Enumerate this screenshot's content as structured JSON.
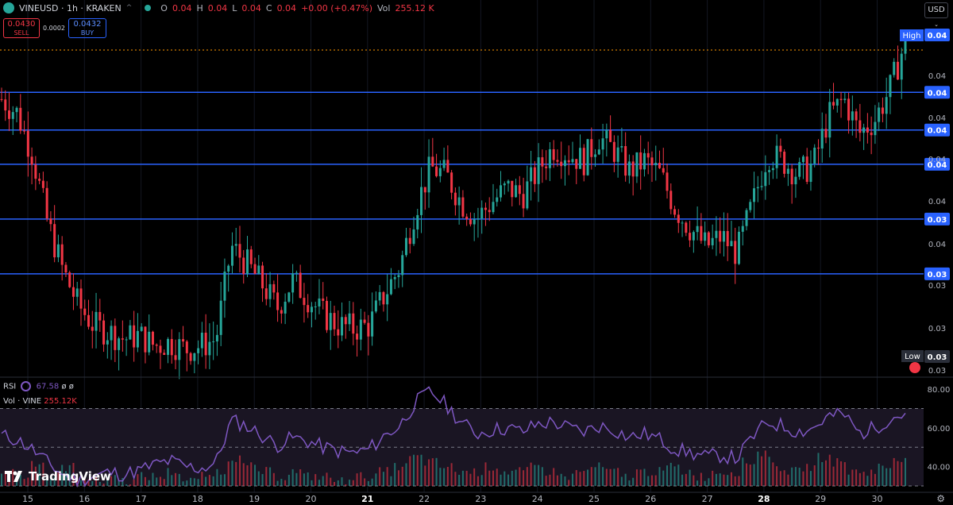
{
  "header": {
    "symbol": "VINEUSD · 1h · KRAKEN",
    "ohlc": [
      {
        "k": "O",
        "v": "0.04"
      },
      {
        "k": "H",
        "v": "0.04"
      },
      {
        "k": "L",
        "v": "0.04"
      },
      {
        "k": "C",
        "v": "0.04"
      }
    ],
    "change": "+0.00 (+0.47%)",
    "vol_label": "Vol",
    "vol_value": "255.12 K"
  },
  "trade": {
    "sell_price": "0.0430",
    "sell_label": "SELL",
    "spread": "0.0002",
    "buy_price": "0.0432",
    "buy_label": "BUY"
  },
  "currency": "USD",
  "price_axis": {
    "tick_labels": [
      "0.04",
      "0.04",
      "0.04",
      "0.04",
      "0.04",
      "0.03",
      "0.03",
      "0.03",
      "0.03"
    ],
    "high_label": "High",
    "high_value": "0.04",
    "low_label": "Low",
    "low_value": "0.03"
  },
  "horizontal_lines": [
    {
      "label": "0.04"
    },
    {
      "label": "0.04"
    },
    {
      "label": "0.04"
    },
    {
      "label": "0.03"
    },
    {
      "label": "0.03"
    }
  ],
  "time_axis": [
    "15",
    "16",
    "17",
    "18",
    "19",
    "20",
    "21",
    "22",
    "23",
    "24",
    "25",
    "26",
    "27",
    "28",
    "29",
    "30"
  ],
  "indicators": {
    "rsi_label": "RSI",
    "rsi_value": "67.58",
    "rsi_extra": "ø ø",
    "vol_label": "Vol · VINE",
    "vol_value": "255.12K",
    "rsi_ticks": [
      "80.00",
      "60.00",
      "40.00"
    ]
  },
  "branding": "TradingView",
  "colors": {
    "bull": "#26a69a",
    "bear": "#f23645",
    "hline": "#2962ff",
    "rsi": "#7e57c2",
    "high_line": "#ff9800"
  },
  "chart_data": [
    {
      "type": "candlestick",
      "title": "VINEUSD · 1h · KRAKEN",
      "x_categories": [
        "15",
        "16",
        "17",
        "18",
        "19",
        "20",
        "21",
        "22",
        "23",
        "24",
        "25",
        "26",
        "27",
        "28",
        "29",
        "30"
      ],
      "close_path": [
        0.0388,
        0.0384,
        0.0372,
        0.0352,
        0.0338,
        0.0328,
        0.0322,
        0.032,
        0.0318,
        0.0319,
        0.0316,
        0.0317,
        0.0315,
        0.0316,
        0.0318,
        0.0345,
        0.034,
        0.0334,
        0.0327,
        0.0335,
        0.033,
        0.0325,
        0.0322,
        0.0321,
        0.0322,
        0.0331,
        0.0339,
        0.0356,
        0.0368,
        0.0366,
        0.0358,
        0.0353,
        0.0358,
        0.0362,
        0.036,
        0.0367,
        0.0374,
        0.0372,
        0.037,
        0.0377,
        0.0373,
        0.0367,
        0.037,
        0.0366,
        0.0356,
        0.035,
        0.0345,
        0.0348,
        0.0343,
        0.0357,
        0.0372,
        0.037,
        0.0366,
        0.0369,
        0.0383,
        0.0388,
        0.0378,
        0.0382,
        0.0391,
        0.0405
      ],
      "hlines": [
        0.039,
        0.0379,
        0.0369,
        0.0353,
        0.0337
      ],
      "ylim": [
        0.0308,
        0.041
      ]
    },
    {
      "type": "line",
      "title": "RSI",
      "ylabel": "",
      "ylim": [
        30,
        85
      ],
      "values": [
        56,
        54,
        49,
        42,
        36,
        33,
        35,
        37,
        36,
        38,
        41,
        43,
        40,
        39,
        42,
        64,
        61,
        56,
        51,
        55,
        53,
        50,
        48,
        47,
        49,
        56,
        61,
        73,
        79,
        72,
        63,
        57,
        59,
        60,
        58,
        62,
        63,
        60,
        58,
        61,
        59,
        55,
        57,
        54,
        49,
        47,
        45,
        46,
        44,
        55,
        63,
        61,
        58,
        60,
        66,
        67,
        57,
        60,
        65,
        67.58
      ]
    },
    {
      "type": "bar",
      "title": "Vol · VINE",
      "values": [
        3,
        2,
        5,
        2,
        4,
        2,
        1,
        2,
        1,
        2,
        2,
        3,
        1,
        2,
        3,
        6,
        4,
        3,
        2,
        3,
        2,
        2,
        1,
        2,
        2,
        3,
        4,
        6,
        5,
        4,
        3,
        3,
        4,
        3,
        3,
        4,
        3,
        2,
        3,
        4,
        3,
        2,
        3,
        3,
        4,
        3,
        2,
        3,
        3,
        5,
        7,
        4,
        3,
        4,
        6,
        5,
        3,
        3,
        4,
        6
      ]
    }
  ]
}
